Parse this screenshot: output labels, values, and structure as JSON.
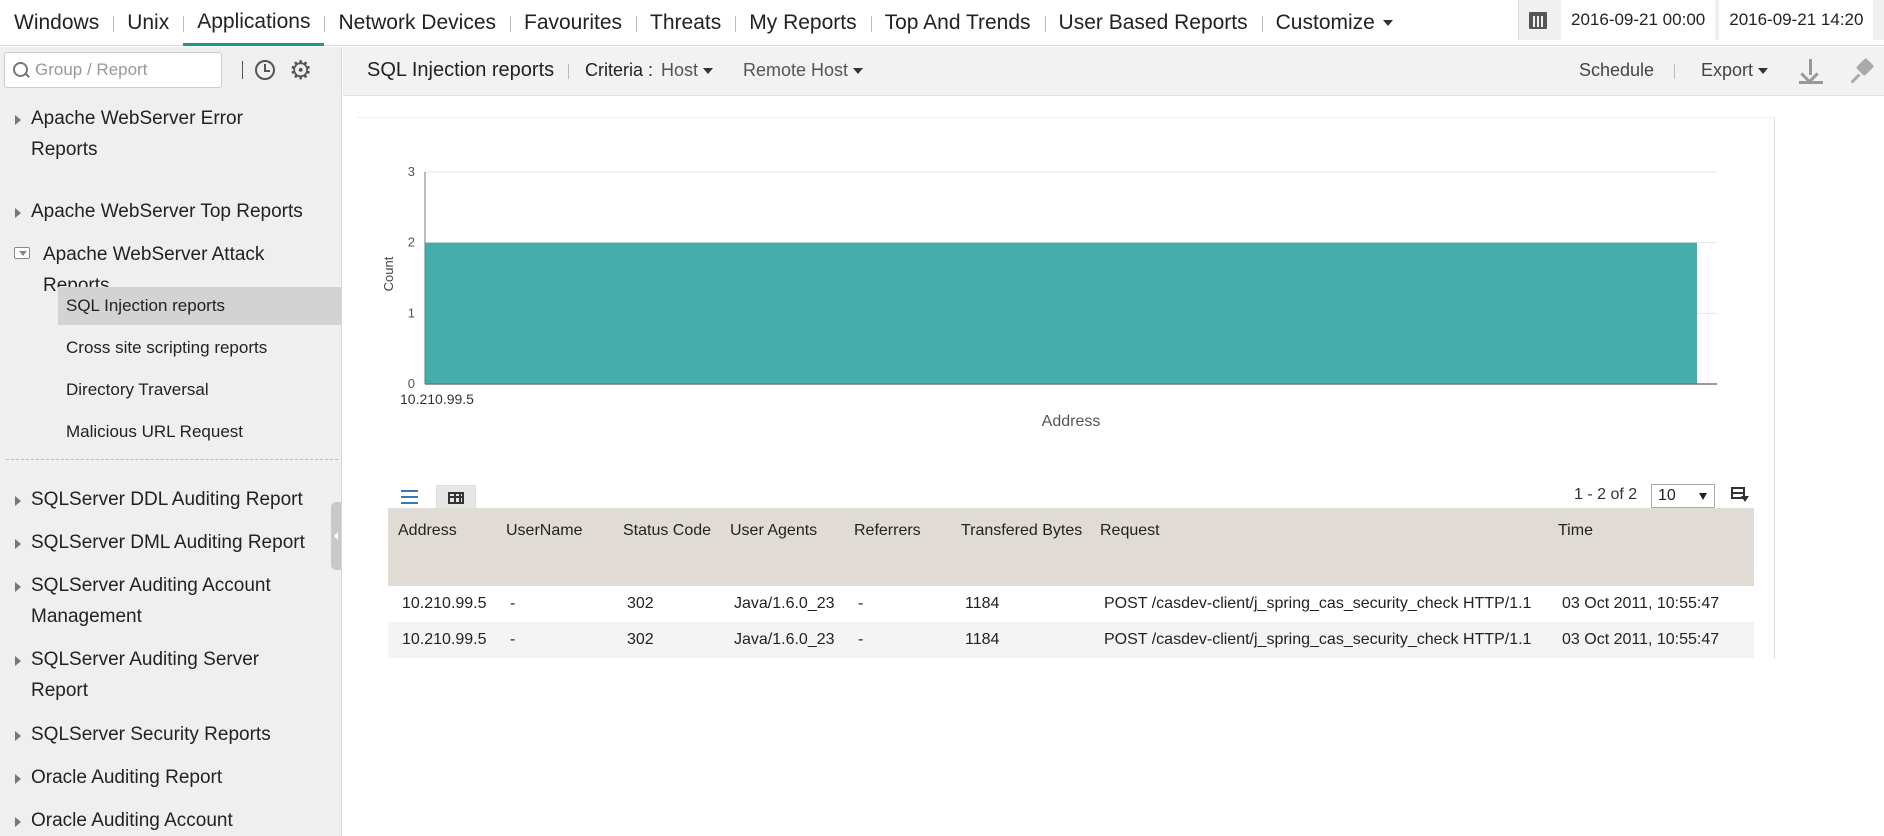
{
  "nav": {
    "tabs": [
      "Windows",
      "Unix",
      "Applications",
      "Network Devices",
      "Favourites",
      "Threats",
      "My Reports",
      "Top And Trends",
      "User Based Reports"
    ],
    "customize_label": "Customize",
    "active_tab": "Applications"
  },
  "date_range": {
    "start": "2016-09-21 00:00",
    "end": "2016-09-21 14:20"
  },
  "sidebar": {
    "search_placeholder": "Group / Report",
    "groups": [
      {
        "label": "Apache WebServer Error Reports"
      },
      {
        "label": "Apache WebServer Top Reports"
      },
      {
        "label": "Apache WebServer Attack Reports",
        "expanded": true
      }
    ],
    "sub_items": [
      "SQL Injection reports",
      "Cross site scripting reports",
      "Directory Traversal",
      "Malicious URL Request"
    ],
    "selected_sub_item": "SQL Injection reports",
    "more_groups": [
      "SQLServer DDL Auditing Report",
      "SQLServer DML Auditing Report",
      "SQLServer Auditing Account Management",
      "SQLServer Auditing Server Report",
      "SQLServer Security Reports",
      "Oracle Auditing Report",
      "Oracle Auditing Account"
    ]
  },
  "report": {
    "title": "SQL Injection reports",
    "criteria_label": "Criteria :",
    "criteria_value": "Host",
    "remote_host_label": "Remote Host",
    "schedule_label": "Schedule",
    "export_label": "Export"
  },
  "chart_data": {
    "type": "bar",
    "categories": [
      "10.210.99.5"
    ],
    "values": [
      2
    ],
    "xlabel": "Address",
    "ylabel": "Count",
    "ylim": [
      0,
      3
    ],
    "yticks": [
      0,
      1,
      2,
      3
    ],
    "color": "#45aeaa",
    "grid": true
  },
  "table": {
    "pager": "1 - 2 of 2",
    "page_size": "10",
    "columns": [
      "Address",
      "UserName",
      "Status Code",
      "User Agents",
      "Referrers",
      "Transfered Bytes",
      "Request",
      "Time"
    ],
    "rows": [
      [
        "10.210.99.5",
        "-",
        "302",
        "Java/1.6.0_23",
        "-",
        "1184",
        "POST /casdev-client/j_spring_cas_security_check HTTP/1.1",
        "03 Oct 2011, 10:55:47"
      ],
      [
        "10.210.99.5",
        "-",
        "302",
        "Java/1.6.0_23",
        "-",
        "1184",
        "POST /casdev-client/j_spring_cas_security_check HTTP/1.1",
        "03 Oct 2011, 10:55:47"
      ]
    ]
  }
}
